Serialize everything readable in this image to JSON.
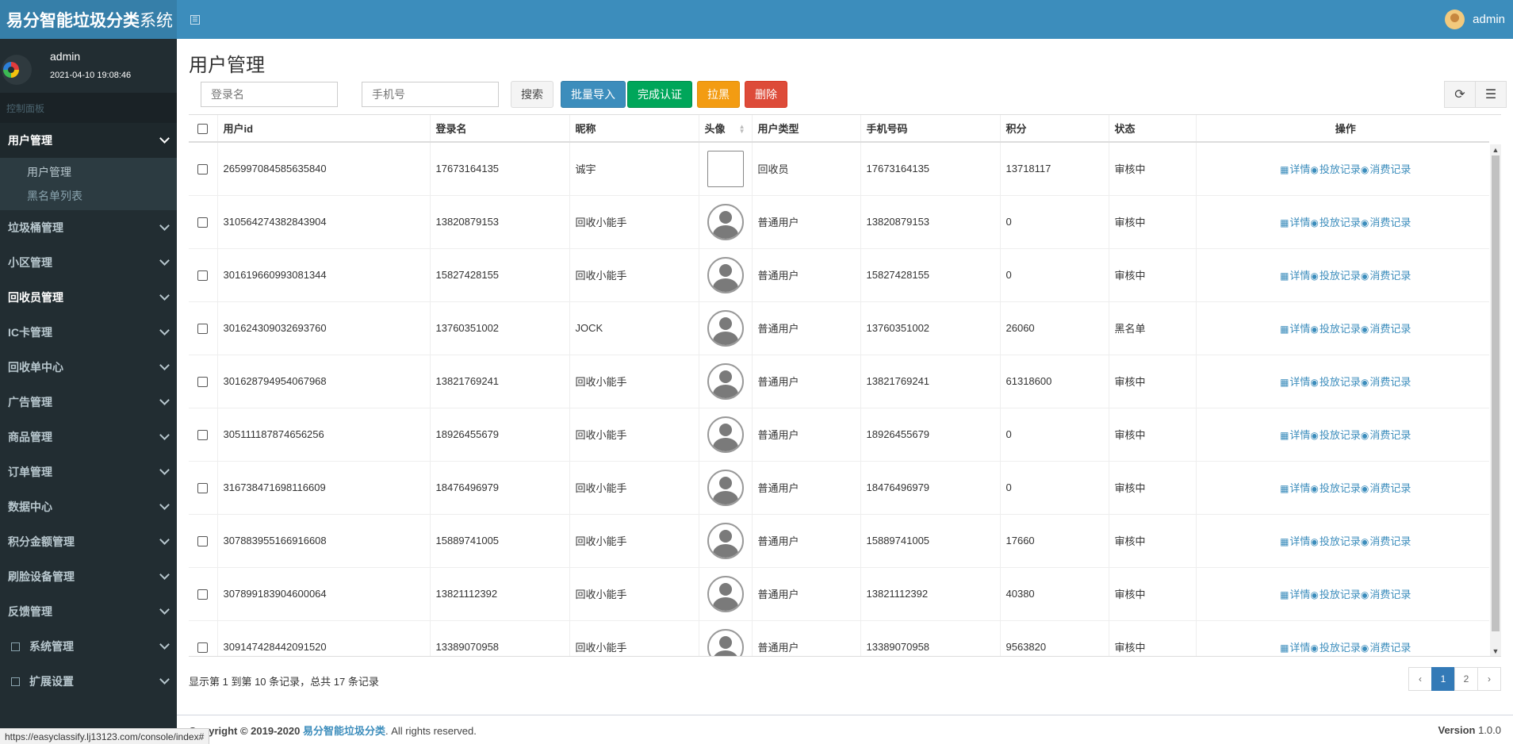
{
  "header": {
    "brand_bold": "易分智能垃圾分类",
    "brand_normal": "系统",
    "user": "admin"
  },
  "sidebar": {
    "user_name": "admin",
    "user_time": "2021-04-10 19:08:46",
    "section_label": "控制面板",
    "menu": [
      {
        "label": "用户管理"
      },
      {
        "label": "垃圾桶管理"
      },
      {
        "label": "小区管理"
      },
      {
        "label": "回收员管理"
      },
      {
        "label": "IC卡管理"
      },
      {
        "label": "回收单中心"
      },
      {
        "label": "广告管理"
      },
      {
        "label": "商品管理"
      },
      {
        "label": "订单管理"
      },
      {
        "label": "数据中心"
      },
      {
        "label": "积分金额管理"
      },
      {
        "label": "刷脸设备管理"
      },
      {
        "label": "反馈管理"
      },
      {
        "label": "系统管理"
      },
      {
        "label": "扩展设置"
      }
    ],
    "submenu": [
      "用户管理",
      "黑名单列表"
    ]
  },
  "main": {
    "title": "用户管理",
    "search_login_placeholder": "登录名",
    "search_phone_placeholder": "手机号",
    "btn_search": "搜索",
    "btn_import": "批量导入",
    "btn_verify": "完成认证",
    "btn_blacklist": "拉黑",
    "btn_delete": "删除"
  },
  "table": {
    "headers": [
      "用户id",
      "登录名",
      "昵称",
      "头像",
      "用户类型",
      "手机号码",
      "积分",
      "状态",
      "操作"
    ],
    "op_detail": "详情",
    "op_drop": "投放记录",
    "op_consume": "消费记录",
    "rows": [
      {
        "id": "265997084585635840",
        "login": "17673164135",
        "nick": "诚宇",
        "type": "回收员",
        "phone": "17673164135",
        "points": "13718117",
        "status": "审核中"
      },
      {
        "id": "310564274382843904",
        "login": "13820879153",
        "nick": "回收小能手",
        "type": "普通用户",
        "phone": "13820879153",
        "points": "0",
        "status": "审核中"
      },
      {
        "id": "301619660993081344",
        "login": "15827428155",
        "nick": "回收小能手",
        "type": "普通用户",
        "phone": "15827428155",
        "points": "0",
        "status": "审核中"
      },
      {
        "id": "301624309032693760",
        "login": "13760351002",
        "nick": "JOCK",
        "type": "普通用户",
        "phone": "13760351002",
        "points": "26060",
        "status": "黑名单"
      },
      {
        "id": "301628794954067968",
        "login": "13821769241",
        "nick": "回收小能手",
        "type": "普通用户",
        "phone": "13821769241",
        "points": "61318600",
        "status": "审核中"
      },
      {
        "id": "305111187874656256",
        "login": "18926455679",
        "nick": "回收小能手",
        "type": "普通用户",
        "phone": "18926455679",
        "points": "0",
        "status": "审核中"
      },
      {
        "id": "316738471698116609",
        "login": "18476496979",
        "nick": "回收小能手",
        "type": "普通用户",
        "phone": "18476496979",
        "points": "0",
        "status": "审核中"
      },
      {
        "id": "307883955166916608",
        "login": "15889741005",
        "nick": "回收小能手",
        "type": "普通用户",
        "phone": "15889741005",
        "points": "17660",
        "status": "审核中"
      },
      {
        "id": "307899183904600064",
        "login": "13821112392",
        "nick": "回收小能手",
        "type": "普通用户",
        "phone": "13821112392",
        "points": "40380",
        "status": "审核中"
      },
      {
        "id": "309147428442091520",
        "login": "13389070958",
        "nick": "回收小能手",
        "type": "普通用户",
        "phone": "13389070958",
        "points": "9563820",
        "status": "审核中"
      }
    ]
  },
  "pagination": {
    "summary": "显示第 1 到第 10 条记录，总共 17 条记录",
    "prev": "‹",
    "pages": [
      "1",
      "2"
    ],
    "next": "›"
  },
  "footer": {
    "left_prefix": "Copyright © 2019-2020 ",
    "brand": "易分智能垃圾分类",
    "left_suffix": ". All rights reserved.",
    "version_label": "Version",
    "version": "1.0.0"
  },
  "statusbar": {
    "url": "https://easyclassify.lj13123.com/console/index#"
  }
}
